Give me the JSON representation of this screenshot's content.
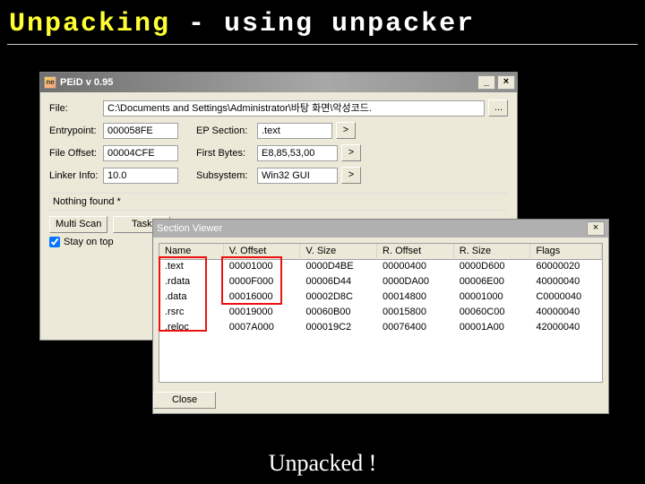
{
  "slide": {
    "title_word": "Unpacking",
    "title_rest": " - using unpacker",
    "unpacked_label": "Unpacked !"
  },
  "peid": {
    "title": "PEiD v 0.95",
    "ne": "ne",
    "min": "_",
    "close": "×",
    "file_label": "File:",
    "file_value": "C:\\Documents and Settings\\Administrator\\바탕 화면\\악성코드.",
    "browse": "...",
    "entry_label": "Entrypoint:",
    "entry_value": "000058FE",
    "ep_label": "EP Section:",
    "ep_value": ".text",
    "fo_label": "File Offset:",
    "fo_value": "00004CFE",
    "fb_label": "First Bytes:",
    "fb_value": "E8,85,53,00",
    "li_label": "Linker Info:",
    "li_value": "10.0",
    "ss_label": "Subsystem:",
    "ss_value": "Win32 GUI",
    "arrow": ">",
    "status": "Nothing found *",
    "multi_scan": "Multi Scan",
    "task": "Task",
    "stay_on_top": "Stay on top"
  },
  "sv": {
    "title": "Section Viewer",
    "close_x": "×",
    "close_btn": "Close",
    "hdr": {
      "name": "Name",
      "voff": "V. Offset",
      "vsize": "V. Size",
      "roff": "R. Offset",
      "rsize": "R. Size",
      "flags": "Flags"
    },
    "rows": [
      {
        "name": ".text",
        "voff": "00001000",
        "vsize": "0000D4BE",
        "roff": "00000400",
        "rsize": "0000D600",
        "flags": "60000020"
      },
      {
        "name": ".rdata",
        "voff": "0000F000",
        "vsize": "00006D44",
        "roff": "0000DA00",
        "rsize": "00006E00",
        "flags": "40000040"
      },
      {
        "name": ".data",
        "voff": "00016000",
        "vsize": "00002D8C",
        "roff": "00014800",
        "rsize": "00001000",
        "flags": "C0000040"
      },
      {
        "name": ".rsrc",
        "voff": "00019000",
        "vsize": "00060B00",
        "roff": "00015800",
        "rsize": "00060C00",
        "flags": "40000040"
      },
      {
        "name": ".reloc",
        "voff": "0007A000",
        "vsize": "000019C2",
        "roff": "00076400",
        "rsize": "00001A00",
        "flags": "42000040"
      }
    ]
  }
}
